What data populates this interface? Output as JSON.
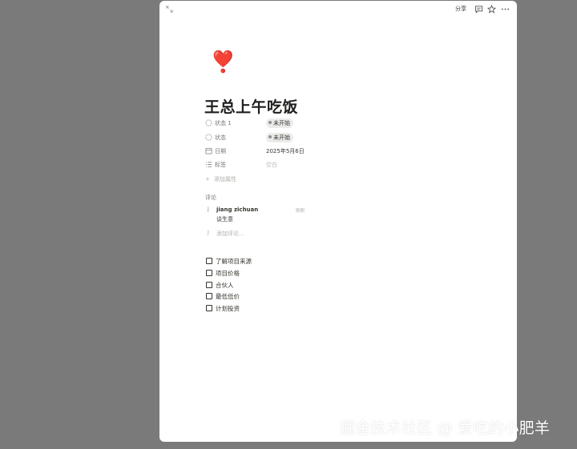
{
  "topbar": {
    "share_label": "分享"
  },
  "icons": {
    "expand": "expand-icon",
    "comment": "comment-icon",
    "star": "star-icon",
    "more": "more-icon"
  },
  "page": {
    "emoji": "❣️",
    "title": "王总上午吃饭"
  },
  "properties": [
    {
      "icon": "status-icon",
      "label": "状态 1",
      "value": "未开始",
      "type": "status"
    },
    {
      "icon": "status-icon",
      "label": "状态",
      "value": "未开始",
      "type": "status"
    },
    {
      "icon": "calendar-icon",
      "label": "日期",
      "value": "2025年5月6日",
      "type": "date"
    },
    {
      "icon": "list-icon",
      "label": "标签",
      "value": "空白",
      "type": "empty"
    }
  ],
  "add_property_label": "添加属性",
  "comments": {
    "heading": "评论",
    "items": [
      {
        "author": "jiang zichuan",
        "time": "刚刚",
        "text": "谈生意"
      }
    ],
    "add_placeholder": "添加评论..."
  },
  "todos": [
    {
      "text": "了解项目来源",
      "checked": false
    },
    {
      "text": "项目价格",
      "checked": false
    },
    {
      "text": "合伙人",
      "checked": false
    },
    {
      "text": "最低低价",
      "checked": false
    },
    {
      "text": "计划投资",
      "checked": false
    }
  ],
  "watermark": "掘金技术社区 @ 爱吃的小肥羊",
  "colors": {
    "backdrop": "#7a7a7a",
    "panel": "#ffffff",
    "text": "#37352f",
    "muted": "#787774",
    "pill": "#ebebea"
  }
}
